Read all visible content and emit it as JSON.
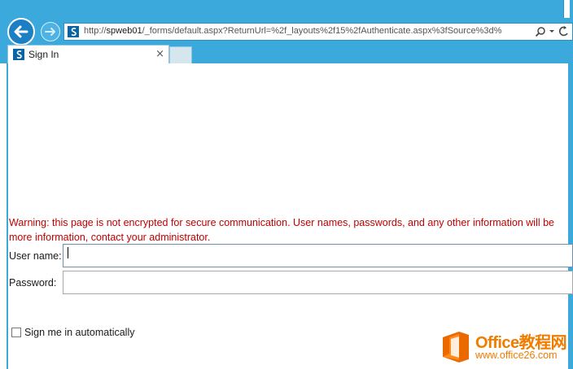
{
  "browser": {
    "url_prefix": "http://",
    "url_host": "spweb01",
    "url_rest": "/_forms/default.aspx?ReturnUrl=%2f_layouts%2f15%2fAuthenticate.aspx%3fSource%3d%",
    "tab_title": "Sign In",
    "tab_close": "×",
    "colors": {
      "chrome": "#3ba9dc",
      "back_button": "#1c7fc4"
    }
  },
  "page": {
    "warning_line1": "Warning: this page is not encrypted for secure communication. User names, passwords, and any other information will be",
    "warning_line2": "more information, contact your administrator.",
    "username_label": "User name:",
    "username_value": "",
    "password_label": "Password:",
    "password_value": "",
    "remember_label": "Sign me in automatically",
    "remember_checked": false,
    "warning_color": "#c00000"
  },
  "watermark": {
    "title": "Office教程网",
    "url": "www.office26.com"
  },
  "icons": {
    "back": "back-arrow-icon",
    "forward": "forward-arrow-icon",
    "site": "sharepoint-icon",
    "search": "search-icon",
    "dropdown": "chevron-down-icon",
    "refresh": "refresh-icon"
  }
}
